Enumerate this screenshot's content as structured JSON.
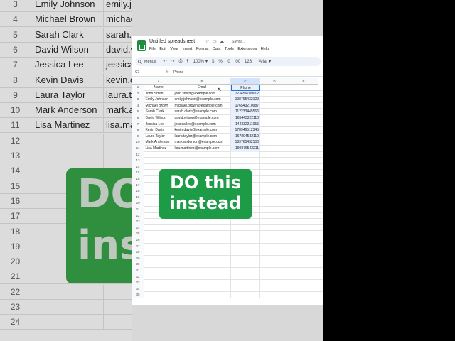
{
  "document": {
    "title": "Untitled spreadsheet",
    "status": "Saving..."
  },
  "menu": [
    "File",
    "Edit",
    "View",
    "Insert",
    "Format",
    "Data",
    "Tools",
    "Extensions",
    "Help"
  ],
  "toolbar": {
    "menus_label": "Menus",
    "zoom": "100%",
    "currency": "$",
    "percent": "%",
    "decimals_less": ".0",
    "decimals_more": ".00",
    "number_format": "123",
    "font": "Arial"
  },
  "formula_bar": {
    "cell_ref": "C1",
    "fx": "fx",
    "value": "Phone"
  },
  "columns": [
    "A",
    "B",
    "C",
    "D",
    "E"
  ],
  "headers": [
    "Name",
    "Email",
    "Phone"
  ],
  "rows": [
    [
      "John Smith",
      "john.smith@example.com",
      "123456789012"
    ],
    [
      "Emily Johnson",
      "emily.johnson@example.com",
      "198765432109"
    ],
    [
      "Michael Brown",
      "michael.brown@example.com",
      "176543210987"
    ],
    [
      "Sarah Clark",
      "sarah.clark@example.com",
      "112233445566"
    ],
    [
      "David Wilson",
      "david.wilson@example.com",
      "165443322110"
    ],
    [
      "Jessica Lee",
      "jessica.lee@example.com",
      "144332211055"
    ],
    [
      "Kevin Davis",
      "kevin.davis@example.com",
      "178946512345"
    ],
    [
      "Laura Taylor",
      "laura.taylor@example.com",
      "167894532110"
    ],
    [
      "Mark Anderson",
      "mark.anderson@example.com",
      "189765432100"
    ],
    [
      "Lisa Martinez",
      "lisa.martinez@example.com",
      "190876543211"
    ]
  ],
  "row_numbers": [
    "1",
    "2",
    "3",
    "4",
    "5",
    "6",
    "7",
    "8",
    "9",
    "10",
    "11",
    "12",
    "13",
    "14",
    "15",
    "16",
    "17",
    "18",
    "19",
    "20",
    "21",
    "22",
    "23",
    "24",
    "25",
    "26",
    "27",
    "28",
    "29",
    "30",
    "31",
    "32",
    "33",
    "34",
    "35"
  ],
  "background": {
    "rows": [
      {
        "num": "3",
        "name": "Emily Johnson",
        "email": "emily.jo"
      },
      {
        "num": "4",
        "name": "Michael Brown",
        "email": "michael"
      },
      {
        "num": "5",
        "name": "Sarah Clark",
        "email": "sarah.cl"
      },
      {
        "num": "6",
        "name": "David Wilson",
        "email": "david.wi"
      },
      {
        "num": "7",
        "name": "Jessica Lee",
        "email": "jessica.l"
      },
      {
        "num": "8",
        "name": "Kevin Davis",
        "email": "kevin.da"
      },
      {
        "num": "9",
        "name": "Laura Taylor",
        "email": "laura.ta"
      },
      {
        "num": "10",
        "name": "Mark Anderson",
        "email": "mark.an"
      },
      {
        "num": "11",
        "name": "Lisa Martinez",
        "email": "lisa.ma"
      },
      {
        "num": "12",
        "name": "",
        "email": ""
      },
      {
        "num": "13",
        "name": "",
        "email": ""
      },
      {
        "num": "14",
        "name": "",
        "email": ""
      },
      {
        "num": "15",
        "name": "",
        "email": ""
      },
      {
        "num": "16",
        "name": "",
        "email": ""
      },
      {
        "num": "17",
        "name": "",
        "email": ""
      },
      {
        "num": "18",
        "name": "",
        "email": ""
      },
      {
        "num": "19",
        "name": "",
        "email": ""
      },
      {
        "num": "20",
        "name": "",
        "email": ""
      },
      {
        "num": "21",
        "name": "",
        "email": ""
      },
      {
        "num": "22",
        "name": "",
        "email": ""
      },
      {
        "num": "23",
        "name": "",
        "email": ""
      },
      {
        "num": "24",
        "name": "",
        "email": ""
      }
    ],
    "big_text_line1": "DO",
    "big_text_line2": "ins"
  },
  "overlay": {
    "line1": "DO this",
    "line2": "instead"
  },
  "colors": {
    "accent": "#1e9b46",
    "selection": "#1a73e8"
  }
}
